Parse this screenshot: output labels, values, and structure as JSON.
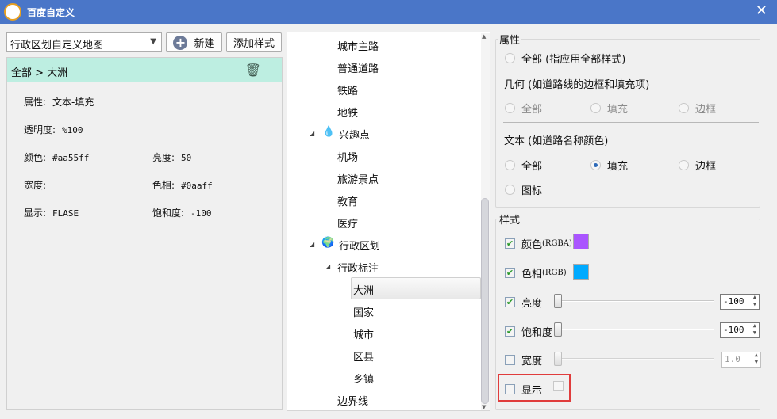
{
  "window": {
    "title": "百度自定义",
    "close": "✕"
  },
  "toolbar": {
    "map_select": "行政区划自定义地图",
    "new_label": "新建",
    "add_style_label": "添加样式"
  },
  "summary": {
    "breadcrumb": "全部 > 大洲",
    "property_label": "属性:",
    "property_value": "文本-填充",
    "opacity_label": "透明度:",
    "opacity_value": "%100",
    "color_label": "颜色:",
    "color_value": "#aa55ff",
    "brightness_label": "亮度:",
    "brightness_value": "50",
    "width_label": "宽度:",
    "width_value": "",
    "hue_label": "色相:",
    "hue_value": "#0aaff",
    "show_label": "显示:",
    "show_value": "FLASE",
    "saturation_label": "饱和度:",
    "saturation_value": "-100"
  },
  "tree": {
    "items": [
      "城市主路",
      "普通道路",
      "铁路",
      "地铁",
      "兴趣点",
      "机场",
      "旅游景点",
      "教育",
      "医疗",
      "行政区划",
      "行政标注",
      "大洲",
      "国家",
      "城市",
      "区县",
      "乡镇",
      "边界线"
    ],
    "selected": "大洲"
  },
  "attributes": {
    "legend": "属性",
    "all_option": "全部 (指应用全部样式)",
    "geometry_heading": "几何 (如道路线的边框和填充项)",
    "geometry_options": [
      "全部",
      "填充",
      "边框"
    ],
    "text_heading": "文本 (如道路名称颜色)",
    "text_options": [
      "全部",
      "填充",
      "边框",
      "图标"
    ],
    "text_selected": "填充"
  },
  "style": {
    "legend": "样式",
    "color": {
      "label": "颜色",
      "suffix": "(RGBA)",
      "checked": true,
      "swatch": "#aa55ff"
    },
    "hue": {
      "label": "色相",
      "suffix": "(RGB)",
      "checked": true,
      "swatch": "#00aaff"
    },
    "brightness": {
      "label": "亮度",
      "checked": true,
      "value": "-100",
      "slider_min": -100,
      "slider_value": -100
    },
    "saturation": {
      "label": "饱和度",
      "checked": true,
      "value": "-100",
      "slider_min": -100,
      "slider_value": -100
    },
    "width": {
      "label": "宽度",
      "checked": false,
      "value": "1.0"
    },
    "show": {
      "label": "显示",
      "checked": false
    }
  },
  "colors": {
    "titlebar": "#4a76c8",
    "selected_row": "#bdeee1",
    "highlight": "#e03c3c"
  }
}
